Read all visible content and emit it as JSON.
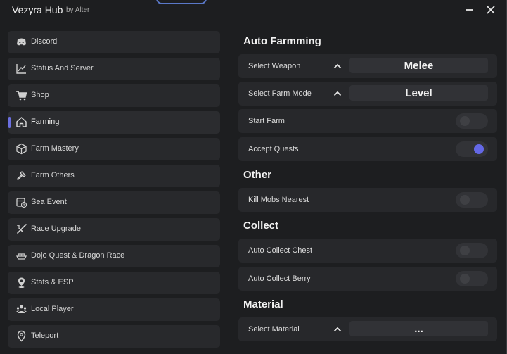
{
  "app": {
    "title": "Vezyra Hub",
    "subtitle": "by Alter"
  },
  "colors": {
    "accent": "#6468e6",
    "background": "#1d1e20",
    "card": "#27282b"
  },
  "sidebar": {
    "items": [
      {
        "label": "Discord",
        "icon": "discord-icon"
      },
      {
        "label": "Status And Server",
        "icon": "chart-line-icon"
      },
      {
        "label": "Shop",
        "icon": "cart-icon"
      },
      {
        "label": "Farming",
        "icon": "home-icon",
        "active": true
      },
      {
        "label": "Farm Mastery",
        "icon": "cube-icon"
      },
      {
        "label": "Farm Others",
        "icon": "hammer-icon"
      },
      {
        "label": "Sea Event",
        "icon": "calendar-clock-icon"
      },
      {
        "label": "Race Upgrade",
        "icon": "sword-icon"
      },
      {
        "label": "Dojo Quest & Dragon Race",
        "icon": "ship-icon"
      },
      {
        "label": "Stats & ESP",
        "icon": "map-pin-icon"
      },
      {
        "label": "Local Player",
        "icon": "users-icon"
      },
      {
        "label": "Teleport",
        "icon": "location-icon"
      }
    ]
  },
  "main": {
    "sections": {
      "auto_farming": "Auto Farmming",
      "other": "Other",
      "collect": "Collect",
      "material": "Material"
    },
    "select_weapon": {
      "label": "Select Weapon",
      "value": "Melee"
    },
    "select_farm_mode": {
      "label": "Select Farm Mode",
      "value": "Level"
    },
    "start_farm": {
      "label": "Start Farm",
      "state": "off"
    },
    "accept_quests": {
      "label": "Accept Quests",
      "state": "on"
    },
    "kill_mobs_nearest": {
      "label": "Kill Mobs Nearest",
      "state": "off"
    },
    "auto_collect_chest": {
      "label": "Auto Collect Chest",
      "state": "off"
    },
    "auto_collect_berry": {
      "label": "Auto Collect Berry",
      "state": "off"
    },
    "select_material": {
      "label": "Select Material",
      "value": "..."
    }
  }
}
